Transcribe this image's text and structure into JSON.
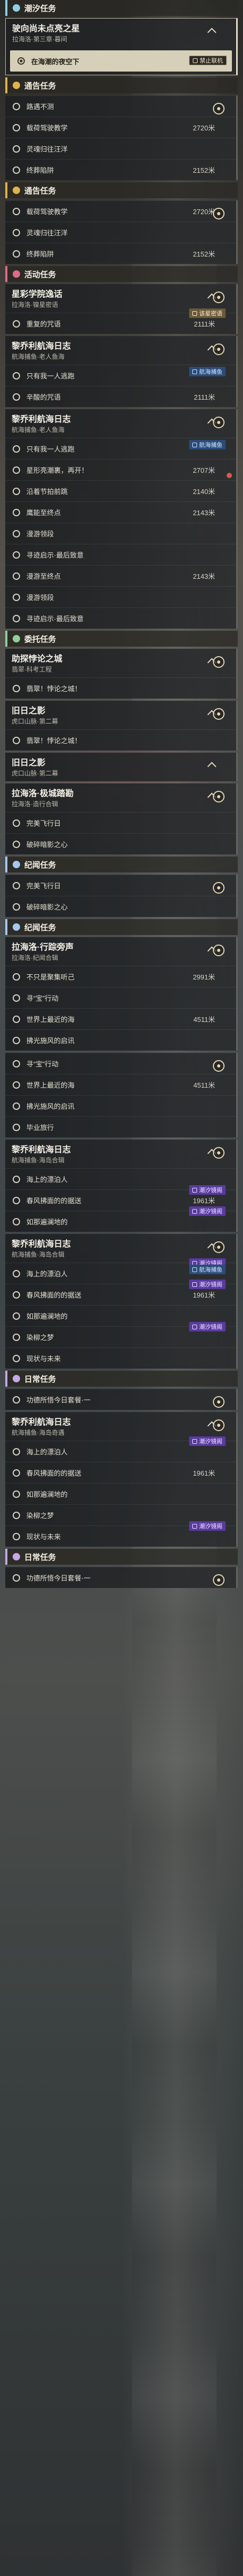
{
  "sections": [
    {
      "label": "潮汐任务",
      "color": "#8fd0e8",
      "tasks": [
        {
          "title": "驶向尚未点亮之星",
          "sub": "拉海洛·第三章·暮间",
          "expanded": true,
          "active": true,
          "steps": [
            {
              "text": "在海潮的夜空下",
              "dist": "",
              "current": true,
              "button": {
                "label": "禁止联机",
                "kind": "b1"
              }
            }
          ]
        }
      ]
    },
    {
      "label": "通告任务",
      "color": "#e0b24a",
      "tasks": [
        {
          "title": "",
          "sub": "",
          "expanded": false,
          "noHead": true,
          "steps": [
            {
              "text": "路遇不测",
              "dist": ""
            },
            {
              "text": "载荷驾驶教学",
              "dist": "2720米"
            },
            {
              "text": "灵魂归往汪洋",
              "dist": ""
            },
            {
              "text": "终葬陷阱",
              "dist": "2152米"
            }
          ]
        }
      ]
    },
    {
      "label": "通告任务",
      "color": "#e0b24a",
      "tasks": [
        {
          "title": "",
          "sub": "",
          "noHead": true,
          "steps": [
            {
              "text": "载荷驾驶教学",
              "dist": "2720米"
            },
            {
              "text": "灵魂归往汪洋",
              "dist": ""
            },
            {
              "text": "终葬陷阱",
              "dist": "2152米"
            }
          ]
        }
      ]
    },
    {
      "label": "活动任务",
      "color": "#e06a8a",
      "tasks": [
        {
          "title": "星彩学院逸话",
          "sub": "拉海洛·镍星密语",
          "steps": [
            {
              "text": "重复的咒语",
              "dist": "2111米",
              "button": {
                "label": "该星密语",
                "kind": "b4"
              }
            }
          ]
        },
        {
          "title": "黎乔利航海日志",
          "sub": "航海捕鱼·老人鱼海",
          "button": {
            "label": "航海捕鱼",
            "kind": "b2"
          },
          "steps": [
            {
              "text": "只有我一人逃跑",
              "dist": ""
            },
            {
              "text": "辛酸的咒语",
              "dist": "2111米"
            }
          ]
        },
        {
          "title": "黎乔利航海日志",
          "sub": "航海捕鱼·老人鱼海",
          "button": {
            "label": "航海捕鱼",
            "kind": "b2"
          },
          "mark": true,
          "steps": [
            {
              "text": "只有我一人逃跑",
              "dist": ""
            },
            {
              "text": "星形亮潮裹，再开！",
              "dist": "2707米"
            },
            {
              "text": "沿着节拍前跳",
              "dist": "2140米"
            },
            {
              "text": "鹰能至终点",
              "dist": "2143米"
            },
            {
              "text": "漫游领段",
              "dist": ""
            },
            {
              "text": "寻迹启示·最后致意",
              "dist": ""
            },
            {
              "text": "漫游至终点",
              "dist": "2143米"
            },
            {
              "text": "漫游领段",
              "dist": ""
            },
            {
              "text": "寻迹启示·最后致意",
              "dist": ""
            }
          ]
        }
      ]
    },
    {
      "label": "委托任务",
      "color": "#8fd09a",
      "tasks": [
        {
          "title": "助探悖论之城",
          "sub": "翡翠·科考工程",
          "steps": [
            {
              "text": "翡翠！悖论之城！",
              "dist": ""
            }
          ]
        },
        {
          "title": "旧日之影",
          "sub": "虎口山脉·第二幕",
          "steps": [
            {
              "text": "翡翠！悖论之城！",
              "dist": ""
            }
          ]
        },
        {
          "title": "旧日之影",
          "sub": "虎口山脉·第二幕",
          "steps": []
        },
        {
          "title": "拉海洛·极城踏勘",
          "sub": "拉海洛·造行合辑",
          "steps": [
            {
              "text": "完美飞行日",
              "dist": ""
            },
            {
              "text": "破碎暗影之心",
              "dist": ""
            }
          ]
        }
      ]
    },
    {
      "label": "纪闻任务",
      "color": "#a5c8f0",
      "tasks": [
        {
          "title": "",
          "sub": "",
          "noHead": true,
          "steps": [
            {
              "text": "完美飞行日",
              "dist": ""
            },
            {
              "text": "破碎暗影之心",
              "dist": ""
            }
          ]
        }
      ]
    },
    {
      "label": "纪闻任务",
      "color": "#a5c8f0",
      "tasks": [
        {
          "title": "拉海洛·行踪旁声",
          "sub": "拉海洛·纪闻合辑",
          "steps": [
            {
              "text": "不只是聚集听己",
              "dist": "2991米"
            },
            {
              "text": "寻“宝”行动",
              "dist": ""
            },
            {
              "text": "世界上最近的海",
              "dist": "4511米"
            },
            {
              "text": "拂光施风的启讯",
              "dist": ""
            }
          ]
        },
        {
          "title": "",
          "sub": "",
          "noHead": true,
          "steps": [
            {
              "text": "寻“宝”行动",
              "dist": ""
            },
            {
              "text": "世界上最近的海",
              "dist": "4511米"
            },
            {
              "text": "拂光施风的启讯",
              "dist": ""
            },
            {
              "text": "毕业旅行",
              "dist": ""
            }
          ]
        },
        {
          "title": "黎乔利航海日志",
          "sub": "航海捕鱼·海岛合辑",
          "steps": [
            {
              "text": "海上的漂泊人",
              "dist": ""
            },
            {
              "text": "春风拂面的的据送",
              "dist": "1961米",
              "button": {
                "label": "潮汐镜阁",
                "kind": "b3"
              }
            },
            {
              "text": "如那遍澜地的",
              "dist": "",
              "button": {
                "label": "潮汐镜阁",
                "kind": "b3"
              }
            }
          ]
        },
        {
          "title": "黎乔利航海日志",
          "sub": "航海捕鱼·海岛合辑",
          "button": {
            "label": "航海捕鱼",
            "kind": "b2"
          },
          "steps": [
            {
              "text": "海上的漂泊人",
              "dist": "",
              "button": {
                "label": "潮汐镜阁",
                "kind": "b3"
              }
            },
            {
              "text": "春风拂面的的据送",
              "dist": "1961米",
              "button": {
                "label": "潮汐镜阁",
                "kind": "b3"
              }
            },
            {
              "text": "如那遍澜地的",
              "dist": ""
            },
            {
              "text": "染柳之梦",
              "dist": "",
              "button": {
                "label": "潮汐镜阁",
                "kind": "b3"
              }
            },
            {
              "text": "现状与未来",
              "dist": ""
            }
          ]
        }
      ]
    },
    {
      "label": "日常任务",
      "color": "#c6a8e6",
      "tasks": [
        {
          "title": "",
          "sub": "",
          "noHead": true,
          "steps": [
            {
              "text": "功德所悟今日套餐·一",
              "dist": ""
            }
          ]
        },
        {
          "title": "黎乔利航海日志",
          "sub": "航海捕鱼·海岛奇遇",
          "steps": [
            {
              "text": "海上的漂泊人",
              "dist": "",
              "button": {
                "label": "潮汐镜阁",
                "kind": "b3"
              }
            },
            {
              "text": "春风拂面的的据送",
              "dist": "1961米"
            },
            {
              "text": "如那遍澜地的",
              "dist": ""
            },
            {
              "text": "染柳之梦",
              "dist": ""
            },
            {
              "text": "现状与未来",
              "dist": "",
              "button": {
                "label": "潮汐镜阁",
                "kind": "b3"
              }
            }
          ]
        }
      ]
    },
    {
      "label": "日常任务",
      "color": "#c6a8e6",
      "tasks": [
        {
          "title": "",
          "sub": "",
          "noHead": true,
          "steps": [
            {
              "text": "功德所悟今日套餐·一",
              "dist": ""
            }
          ]
        }
      ]
    }
  ]
}
